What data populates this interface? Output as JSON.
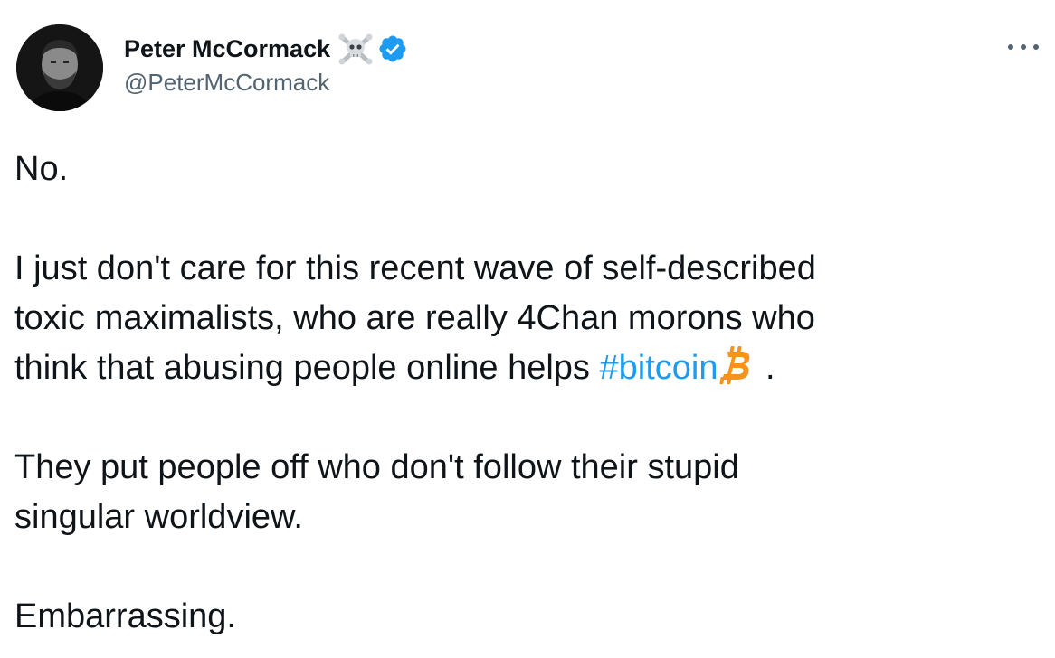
{
  "author": {
    "display_name": "Peter McCormack",
    "handle": "@PeterMcCormack",
    "name_emoji": "skull-and-crossbones-icon",
    "verified": true
  },
  "tweet": {
    "line_1": "No.",
    "para_2_line_1": "I just don't care for this recent wave of self-described",
    "para_2_line_2": "toxic maximalists, who are really 4Chan morons who",
    "para_2_line_3_prefix": "think that abusing people online helps ",
    "hashtag": "#bitcoin",
    "para_2_line_3_suffix": " .",
    "para_3_line_1": "They put people off who don't follow their stupid",
    "para_3_line_2": "singular worldview.",
    "para_4_line_1": "Embarrassing."
  },
  "colors": {
    "text": "#0f1419",
    "secondary_text": "#536471",
    "link": "#1d9bf0",
    "verified_badge": "#1d9bf0",
    "bitcoin_orange": "#f7931a"
  },
  "icons": {
    "more": "more-options-icon",
    "hashtag_emoji": "bitcoin-icon"
  }
}
